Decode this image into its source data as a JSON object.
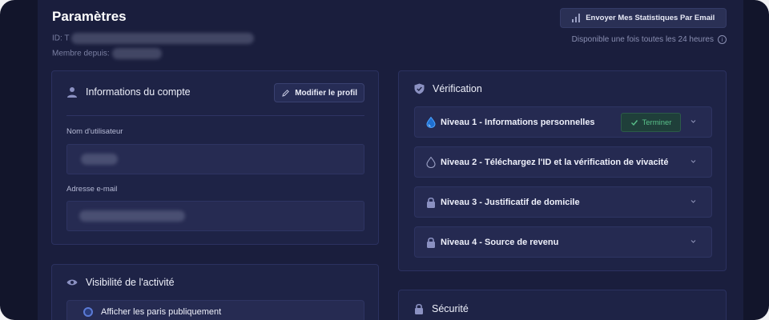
{
  "header": {
    "title": "Paramètres",
    "id_label": "ID: T",
    "member_since_label": "Membre depuis:",
    "email_stats_button": "Envoyer Mes Statistiques Par Email",
    "availability_note": "Disponible une fois toutes les 24 heures"
  },
  "account": {
    "title": "Informations du compte",
    "edit_button": "Modifier le profil",
    "username_label": "Nom d'utilisateur",
    "email_label": "Adresse e-mail"
  },
  "verification": {
    "title": "Vérification",
    "levels": [
      {
        "label": "Niveau 1 - Informations personnelles",
        "status": "Terminer"
      },
      {
        "label": "Niveau 2 - Téléchargez l'ID et la vérification de vivacité"
      },
      {
        "label": "Niveau 3 - Justificatif de domicile"
      },
      {
        "label": "Niveau 4 - Source de revenu"
      }
    ]
  },
  "activity": {
    "title": "Visibilité de l'activité",
    "option": "Afficher les paris publiquement"
  },
  "security": {
    "title": "Sécurité"
  },
  "colors": {
    "background": "#1a1e3d",
    "card": "#1e2346",
    "success": "#59c08a",
    "accent": "#5b7ad6"
  }
}
